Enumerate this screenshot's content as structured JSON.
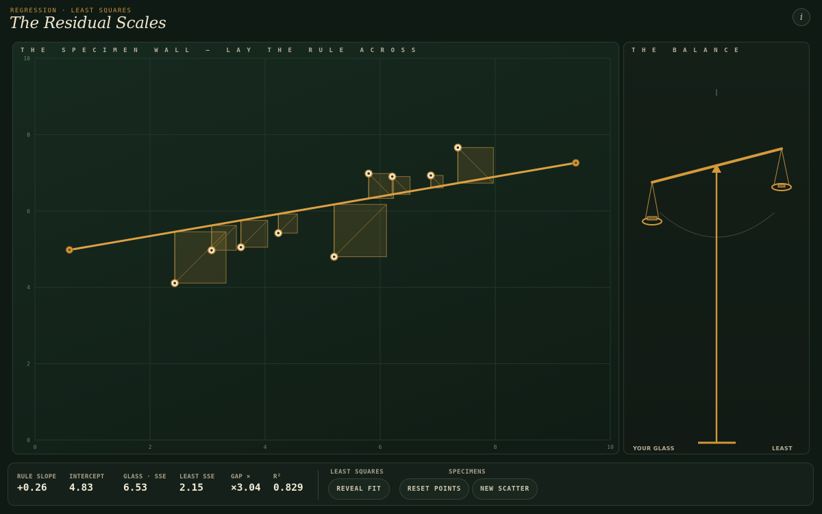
{
  "header": {
    "kicker": "REGRESSION · LEAST SQUARES",
    "title": "The Residual Scales",
    "info_icon": "info-icon"
  },
  "wall": {
    "label": "THE SPECIMEN WALL — LAY THE RULE ACROSS"
  },
  "balance": {
    "label": "THE BALANCE",
    "left_label": "YOUR GLASS",
    "right_label": "LEAST"
  },
  "chart_data": {
    "type": "scatter",
    "x_ticks": [
      "0",
      "2",
      "4",
      "6",
      "8",
      "10"
    ],
    "y_ticks": [
      "0",
      "2",
      "4",
      "6",
      "8",
      "10"
    ],
    "xlim": [
      0,
      10
    ],
    "ylim": [
      0,
      10
    ],
    "grid": true,
    "points": [
      {
        "x": 2.43,
        "y": 4.11
      },
      {
        "x": 3.07,
        "y": 4.97
      },
      {
        "x": 3.58,
        "y": 5.05
      },
      {
        "x": 4.23,
        "y": 5.42
      },
      {
        "x": 5.2,
        "y": 4.8
      },
      {
        "x": 5.8,
        "y": 6.98
      },
      {
        "x": 6.21,
        "y": 6.9
      },
      {
        "x": 6.88,
        "y": 6.93
      },
      {
        "x": 7.35,
        "y": 7.66
      }
    ],
    "rule": {
      "x1": 0.6,
      "y1": 4.98,
      "x2": 9.4,
      "y2": 7.26
    },
    "residual_squares": true
  },
  "stats": [
    {
      "label": "RULE SLOPE",
      "value": "+0.26"
    },
    {
      "label": "INTERCEPT",
      "value": "4.83"
    },
    {
      "label": "GLASS · SSE",
      "value": "6.53"
    },
    {
      "label": "LEAST SSE",
      "value": "2.15"
    },
    {
      "label": "GAP ×",
      "value": "×3.04"
    },
    {
      "label": "R²",
      "value": "0.829"
    }
  ],
  "controls": {
    "least_squares_label": "LEAST SQUARES",
    "specimens_label": "SPECIMENS",
    "reveal_fit": "REVEAL FIT",
    "reset_points": "RESET POINTS",
    "new_scatter": "NEW SCATTER"
  },
  "colors": {
    "accent": "#d59a3a",
    "background": "#0f1a14",
    "text": "#f0e6cf"
  }
}
